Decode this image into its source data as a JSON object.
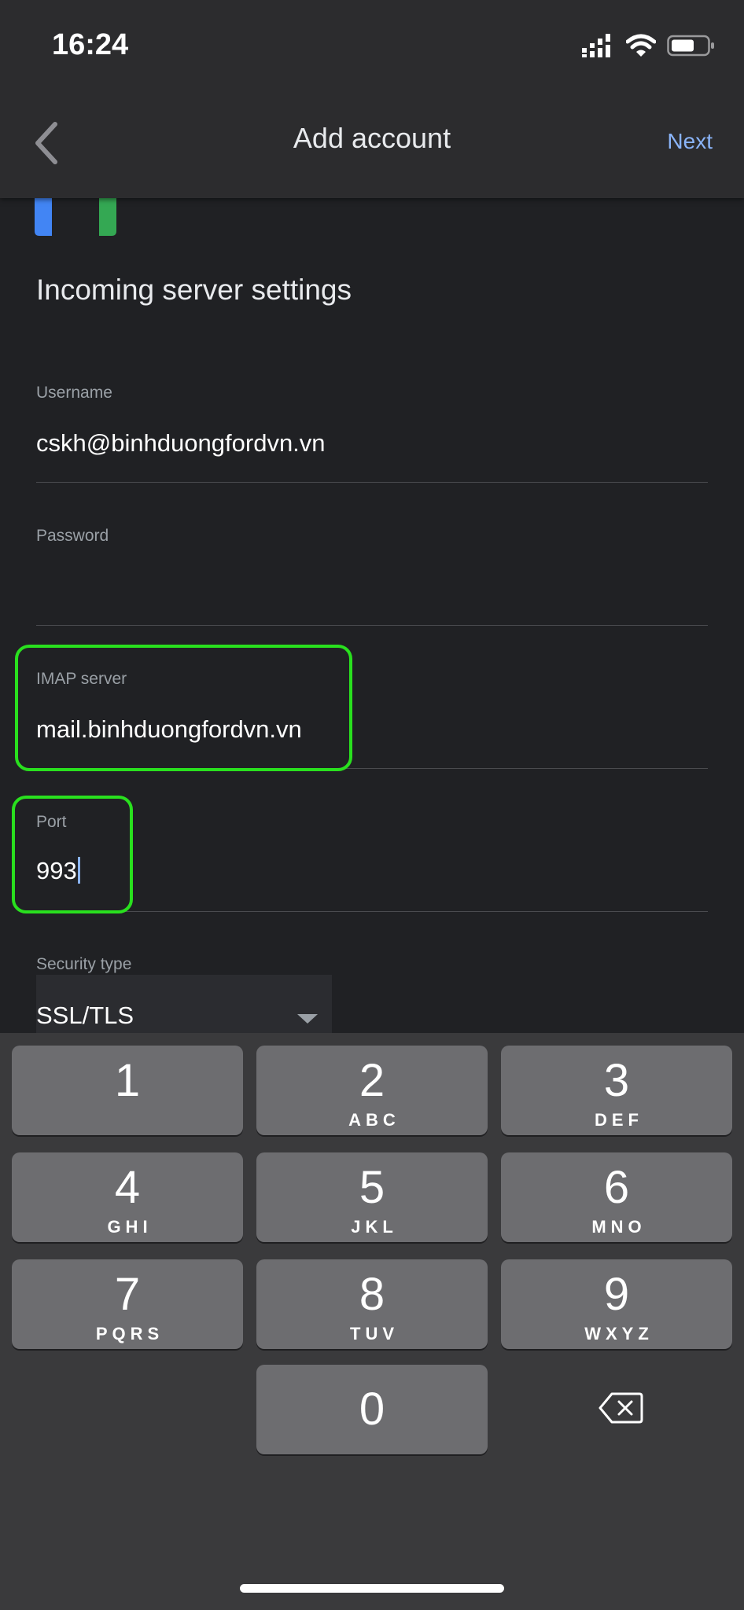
{
  "status_bar": {
    "time": "16:24",
    "icons": [
      "cellular-signal-icon",
      "wifi-icon",
      "battery-icon"
    ]
  },
  "nav": {
    "back_icon": "chevron-left-icon",
    "title": "Add account",
    "next_label": "Next"
  },
  "logo": {
    "icon": "gmail-logo-icon"
  },
  "heading": "Incoming server settings",
  "fields": {
    "username": {
      "label": "Username",
      "value": "cskh@binhduongfordvn.vn"
    },
    "password": {
      "label": "Password",
      "value": ""
    },
    "imap_server": {
      "label": "IMAP server",
      "value": "mail.binhduongfordvn.vn"
    },
    "port": {
      "label": "Port",
      "value": "993"
    },
    "security_type": {
      "label": "Security type",
      "value": "SSL/TLS"
    }
  },
  "keypad": {
    "keys": [
      {
        "digit": "1",
        "letters": ""
      },
      {
        "digit": "2",
        "letters": "ABC"
      },
      {
        "digit": "3",
        "letters": "DEF"
      },
      {
        "digit": "4",
        "letters": "GHI"
      },
      {
        "digit": "5",
        "letters": "JKL"
      },
      {
        "digit": "6",
        "letters": "MNO"
      },
      {
        "digit": "7",
        "letters": "PQRS"
      },
      {
        "digit": "8",
        "letters": "TUV"
      },
      {
        "digit": "9",
        "letters": "WXYZ"
      },
      {
        "digit": "0",
        "letters": ""
      }
    ],
    "delete_icon": "backspace-icon"
  },
  "colors": {
    "accent": "#8ab4f8",
    "highlight": "#29e01e",
    "background": "#202124",
    "keyboard": "#3a3a3c",
    "key": "#6d6d70"
  }
}
